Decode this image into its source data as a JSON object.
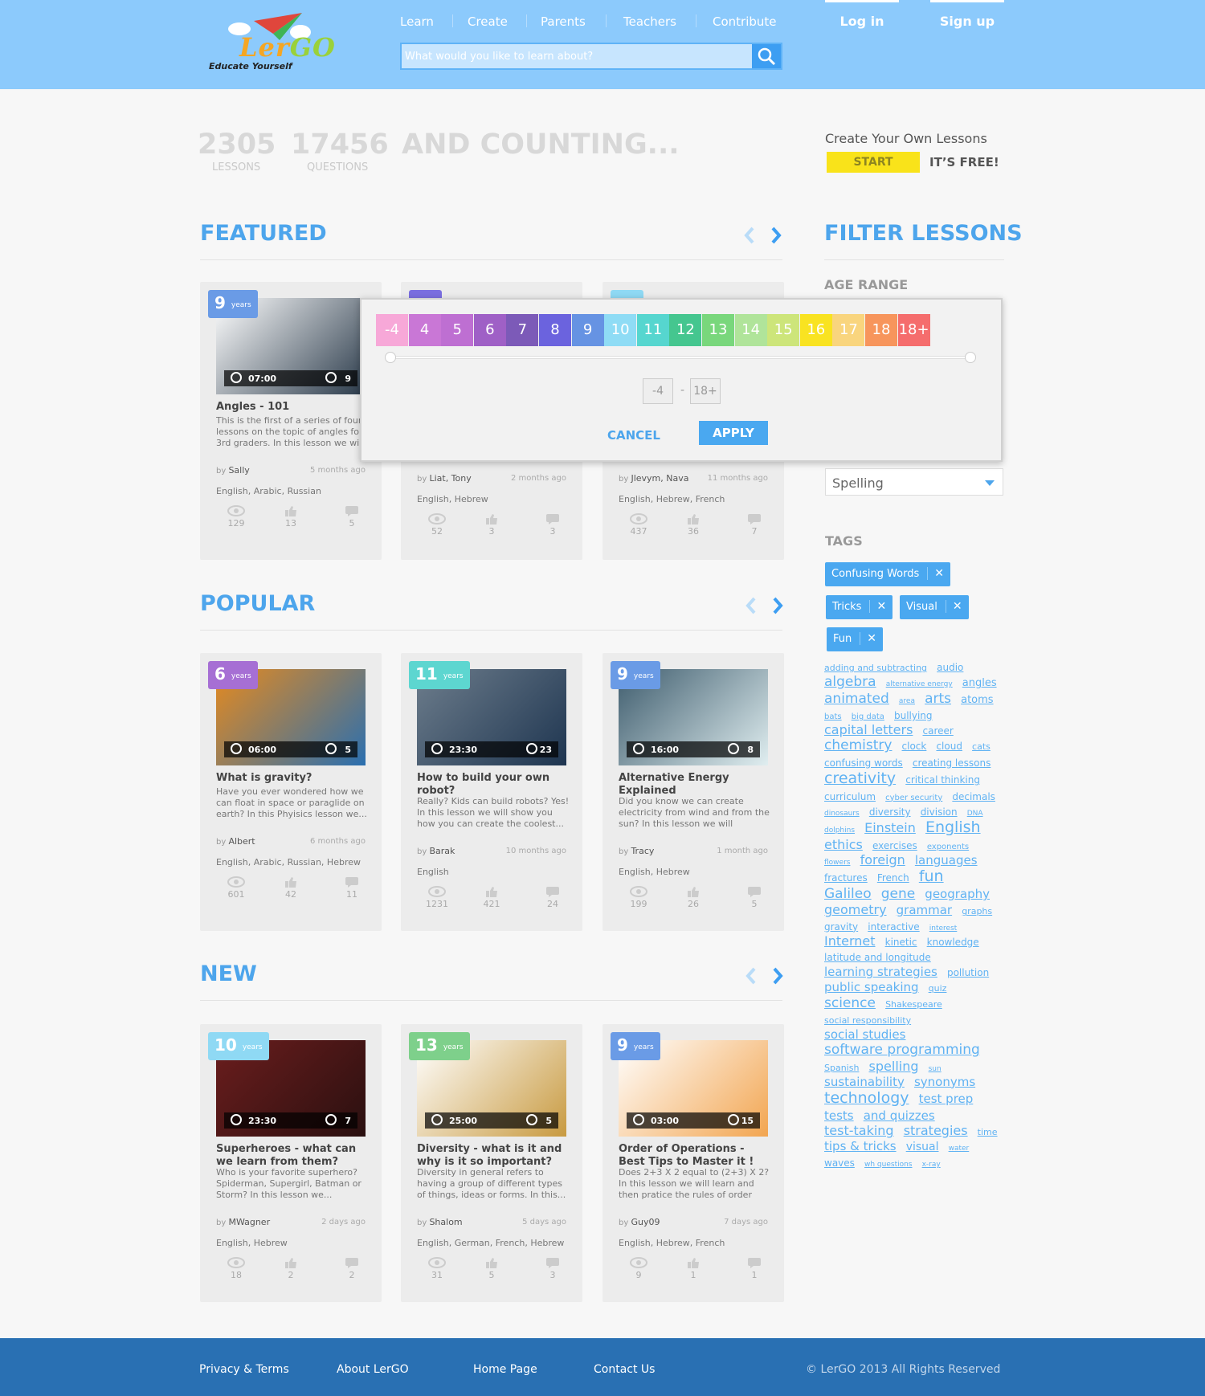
{
  "header": {
    "logo_text": "LerGO",
    "logo_tagline": "Educate Yourself",
    "nav": [
      "Learn",
      "Create",
      "Parents",
      "Teachers",
      "Contribute"
    ],
    "login": "Log in",
    "signup": "Sign up",
    "search_placeholder": "What would you like to learn about?"
  },
  "stats": {
    "lessons_count": "2305",
    "lessons_label": "LESSONS",
    "questions_count": "17456",
    "questions_label": "QUESTIONS",
    "counting": "AND COUNTING..."
  },
  "promo": {
    "text": "Create Your Own Lessons",
    "start": "START",
    "free": "IT’S FREE!"
  },
  "sections": {
    "featured": "FEATURED",
    "popular": "POPULAR",
    "new": "NEW"
  },
  "featured": [
    {
      "age": "9",
      "age_color": "#6a9be6",
      "time": "07:00",
      "questions": "9",
      "title": "Angles - 101",
      "desc": "This is the  first  of a series of four lessons on the topic of angles for 3rd graders. In this lesson we will",
      "by": "Sally",
      "ago": "5 months ago",
      "langs": "English, Arabic, Russian",
      "views": "129",
      "likes": "13",
      "comments": "5"
    },
    {
      "age": "",
      "age_color": "#7a6ee0",
      "time": "",
      "questions": "",
      "title": "",
      "desc": "",
      "by": "Liat, Tony",
      "ago": "2 months ago",
      "langs": "English, Hebrew",
      "views": "52",
      "likes": "3",
      "comments": "3"
    },
    {
      "age": "",
      "age_color": "#8fd9f4",
      "time": "",
      "questions": "",
      "title": "",
      "desc": "",
      "by": "Jlevym, Nava",
      "ago": "11 months ago",
      "langs": "English, Hebrew, French",
      "views": "437",
      "likes": "36",
      "comments": "7"
    }
  ],
  "popular": [
    {
      "age": "6",
      "age_color": "#a66fd4",
      "time": "06:00",
      "questions": "5",
      "title": "What is gravity?",
      "desc": "Have you ever wondered how we can float in space or paraglide on earth? In this Phyisics lesson we...",
      "by": "Albert",
      "ago": "6 months ago",
      "langs": "English, Arabic, Russian, Hebrew",
      "views": "601",
      "likes": "42",
      "comments": "11"
    },
    {
      "age": "11",
      "age_color": "#5dd6d0",
      "time": "23:30",
      "questions": "23",
      "title": "How to build your own robot?",
      "desc": "Really? Kids can build robots? Yes! In this lesson we will show you how you can create the coolest...",
      "by": "Barak",
      "ago": "10 months ago",
      "langs": "English",
      "views": "1231",
      "likes": "421",
      "comments": "24"
    },
    {
      "age": "9",
      "age_color": "#6a9be6",
      "time": "16:00",
      "questions": "8",
      "title": "Alternative Energy Explained",
      "desc": "Did you know we can create electricity from wind and from the sun? In this lesson we will discuss...",
      "by": "Tracy",
      "ago": "1 month ago",
      "langs": "English, Hebrew",
      "views": "199",
      "likes": "26",
      "comments": "5"
    }
  ],
  "new": [
    {
      "age": "10",
      "age_color": "#8fd9f4",
      "time": "23:30",
      "questions": "7",
      "title": "Superheroes - what can we learn from them?",
      "desc": "Who is your favorite superhero? Spiderman, Supergirl, Batman or Storm? In this lesson we...",
      "by": "MWagner",
      "ago": "2 days ago",
      "langs": "English, Hebrew",
      "views": "18",
      "likes": "2",
      "comments": "2"
    },
    {
      "age": "13",
      "age_color": "#7ed08b",
      "time": "25:00",
      "questions": "5",
      "title": "Diversity - what is it and why is it so important?",
      "desc": "Diversity in general refers to having a group of different types of things, ideas or forms. In this...",
      "by": "Shalom",
      "ago": "5 days ago",
      "langs": "English, German, French, Hebrew",
      "views": "31",
      "likes": "5",
      "comments": "3"
    },
    {
      "age": "9",
      "age_color": "#6a9be6",
      "time": "03:00",
      "questions": "15",
      "title": "Order of Operations - Best Tips to Master it !",
      "desc": "Does 2+3 X 2 equal to (2+3) X 2? In this lesson we will learn and then pratice the rules of order of....",
      "by": "Guy09",
      "ago": "7 days ago",
      "langs": "English, Hebrew, French",
      "views": "9",
      "likes": "1",
      "comments": "1"
    }
  ],
  "by_prefix": "by",
  "years_label": "years",
  "filter": {
    "title": "FILTER LESSONS",
    "age_range": "AGE RANGE",
    "subject_value": "Spelling",
    "tags_label": "TAGS",
    "tags": [
      "Confusing Words",
      "Tricks",
      "Visual",
      "Fun"
    ],
    "cloud": [
      {
        "t": "adding and subtracting",
        "s": 11
      },
      {
        "t": "audio",
        "s": 12
      },
      {
        "t": "algebra",
        "s": 17
      },
      {
        "t": "alternative energy",
        "s": 9
      },
      {
        "t": "angles",
        "s": 13
      },
      {
        "t": "animated",
        "s": 17
      },
      {
        "t": "area",
        "s": 9
      },
      {
        "t": "arts",
        "s": 17
      },
      {
        "t": "atoms",
        "s": 13
      },
      {
        "t": "bats",
        "s": 10
      },
      {
        "t": "big data",
        "s": 10
      },
      {
        "t": "bullying",
        "s": 12
      },
      {
        "t": "capital letters",
        "s": 16
      },
      {
        "t": "career",
        "s": 12
      },
      {
        "t": "chemistry",
        "s": 17
      },
      {
        "t": "clock",
        "s": 12
      },
      {
        "t": "cloud",
        "s": 12
      },
      {
        "t": "cats",
        "s": 11
      },
      {
        "t": "confusing words",
        "s": 12
      },
      {
        "t": "creating lessons",
        "s": 12
      },
      {
        "t": "creativity",
        "s": 19
      },
      {
        "t": "critical thinking",
        "s": 12
      },
      {
        "t": "curriculum",
        "s": 12
      },
      {
        "t": "cyber security",
        "s": 10
      },
      {
        "t": "decimals",
        "s": 12
      },
      {
        "t": "dinosaurs",
        "s": 9
      },
      {
        "t": "diversity",
        "s": 12
      },
      {
        "t": "division",
        "s": 12
      },
      {
        "t": "DNA",
        "s": 9
      },
      {
        "t": "dolphins",
        "s": 9
      },
      {
        "t": "Einstein",
        "s": 16
      },
      {
        "t": "English",
        "s": 19
      },
      {
        "t": "ethics",
        "s": 16
      },
      {
        "t": "exercises",
        "s": 12
      },
      {
        "t": "exponents",
        "s": 10
      },
      {
        "t": "flowers",
        "s": 9
      },
      {
        "t": "foreign",
        "s": 16
      },
      {
        "t": "languages",
        "s": 15
      },
      {
        "t": "fractures",
        "s": 12
      },
      {
        "t": "French",
        "s": 12
      },
      {
        "t": "fun",
        "s": 19
      },
      {
        "t": "Galileo",
        "s": 17
      },
      {
        "t": "gene",
        "s": 17
      },
      {
        "t": "geography",
        "s": 15
      },
      {
        "t": "geometry",
        "s": 16
      },
      {
        "t": "grammar",
        "s": 15
      },
      {
        "t": "graphs",
        "s": 11
      },
      {
        "t": "gravity",
        "s": 12
      },
      {
        "t": "interactive",
        "s": 12
      },
      {
        "t": "interest",
        "s": 9
      },
      {
        "t": "Internet",
        "s": 16
      },
      {
        "t": "kinetic",
        "s": 12
      },
      {
        "t": "knowledge",
        "s": 12
      },
      {
        "t": "latitude and longitude",
        "s": 12
      },
      {
        "t": "learning strategies",
        "s": 15
      },
      {
        "t": "pollution",
        "s": 12
      },
      {
        "t": "public speaking",
        "s": 15
      },
      {
        "t": "quiz",
        "s": 11
      },
      {
        "t": "science",
        "s": 17
      },
      {
        "t": "Shakespeare",
        "s": 11
      },
      {
        "t": "social responsibility",
        "s": 11
      },
      {
        "t": "social studies",
        "s": 15
      },
      {
        "t": "software programming",
        "s": 17
      },
      {
        "t": "Spanish",
        "s": 11
      },
      {
        "t": "spelling",
        "s": 16
      },
      {
        "t": "sun",
        "s": 9
      },
      {
        "t": "sustainability",
        "s": 15
      },
      {
        "t": "synonyms",
        "s": 15
      },
      {
        "t": "technology",
        "s": 19
      },
      {
        "t": "test prep",
        "s": 15
      },
      {
        "t": "tests",
        "s": 15
      },
      {
        "t": "and quizzes",
        "s": 15
      },
      {
        "t": "test-taking",
        "s": 16
      },
      {
        "t": "strategies",
        "s": 16
      },
      {
        "t": "time",
        "s": 11
      },
      {
        "t": "tips & tricks",
        "s": 15
      },
      {
        "t": "visual",
        "s": 14
      },
      {
        "t": "water",
        "s": 9
      },
      {
        "t": "waves",
        "s": 12
      },
      {
        "t": "wh questions",
        "s": 9
      },
      {
        "t": "x-ray",
        "s": 9
      }
    ]
  },
  "age_modal": {
    "ages": [
      {
        "v": "-4",
        "c": "#f7a8d8"
      },
      {
        "v": "4",
        "c": "#c977d6"
      },
      {
        "v": "5",
        "c": "#be6fd2"
      },
      {
        "v": "6",
        "c": "#9f60c6"
      },
      {
        "v": "7",
        "c": "#7c5ab8"
      },
      {
        "v": "8",
        "c": "#6b63de"
      },
      {
        "v": "9",
        "c": "#6693e3"
      },
      {
        "v": "10",
        "c": "#8fdcf5"
      },
      {
        "v": "11",
        "c": "#56d6cf"
      },
      {
        "v": "12",
        "c": "#45c68f"
      },
      {
        "v": "13",
        "c": "#79d77c"
      },
      {
        "v": "14",
        "c": "#b0e49a"
      },
      {
        "v": "15",
        "c": "#cde57a"
      },
      {
        "v": "16",
        "c": "#f9e321"
      },
      {
        "v": "17",
        "c": "#f9d57e"
      },
      {
        "v": "18",
        "c": "#f7955c"
      },
      {
        "v": "18+",
        "c": "#f56d6d"
      }
    ],
    "min": "-4",
    "max": "18+",
    "dash": "-",
    "cancel": "CANCEL",
    "apply": "APPLY"
  },
  "footer": {
    "privacy": "Privacy & Terms",
    "about": "About LerGO",
    "home": "Home Page",
    "contact": "Contact Us",
    "copyright": "© LerGO 2013 All Rights Reserved"
  }
}
